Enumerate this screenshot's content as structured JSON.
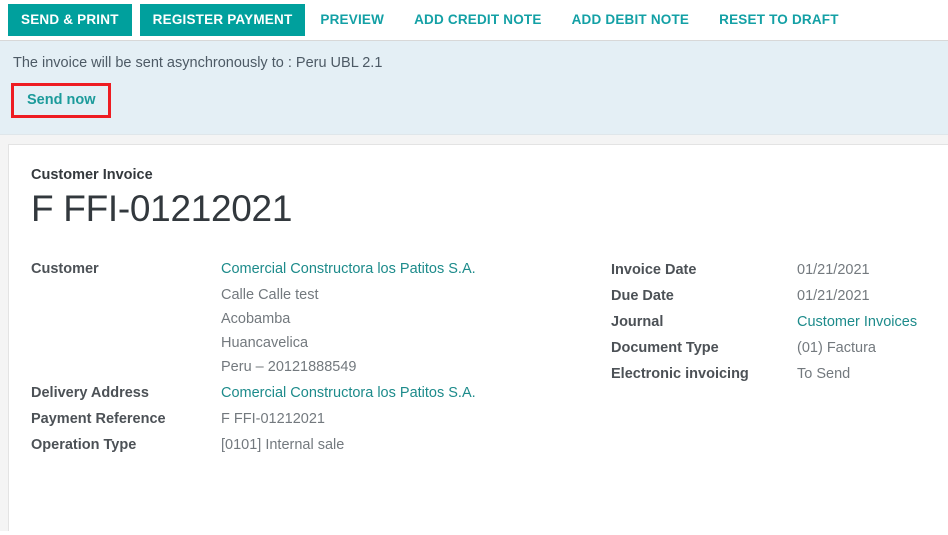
{
  "toolbar": {
    "primary_buttons": [
      {
        "label": "SEND & PRINT",
        "name": "send-and-print"
      },
      {
        "label": "REGISTER PAYMENT",
        "name": "register-payment"
      }
    ],
    "link_buttons": [
      {
        "label": "PREVIEW",
        "name": "preview"
      },
      {
        "label": "ADD CREDIT NOTE",
        "name": "add-credit-note"
      },
      {
        "label": "ADD DEBIT NOTE",
        "name": "add-debit-note"
      },
      {
        "label": "RESET TO DRAFT",
        "name": "reset-to-draft"
      }
    ]
  },
  "banner": {
    "message": "The invoice will be sent asynchronously to : Peru UBL 2.1",
    "send_now_label": "Send now"
  },
  "invoice": {
    "subtitle": "Customer Invoice",
    "number": "F FFI-01212021",
    "left_fields": [
      {
        "label": "Customer",
        "value": "Comercial Constructora los Patitos S.A."
      },
      {
        "label": "Delivery Address",
        "value": "Comercial Constructora los Patitos S.A."
      },
      {
        "label": "Payment Reference",
        "value": "F FFI-01212021"
      },
      {
        "label": "Operation Type",
        "value": "[0101] Internal sale"
      }
    ],
    "customer_address": [
      "Calle Calle test",
      "Acobamba",
      "Huancavelica",
      "Peru – 20121888549"
    ],
    "right_fields": [
      {
        "label": "Invoice Date",
        "value": "01/21/2021"
      },
      {
        "label": "Due Date",
        "value": "01/21/2021"
      },
      {
        "label": "Journal",
        "value": "Customer Invoices"
      },
      {
        "label": "Document Type",
        "value": "(01) Factura"
      },
      {
        "label": "Electronic invoicing",
        "value": "To Send"
      }
    ]
  },
  "colors": {
    "accent_teal": "#00a09d",
    "link_teal": "#13a0a5",
    "banner_bg": "#e4eff5",
    "highlight_red": "#ee1c22"
  }
}
